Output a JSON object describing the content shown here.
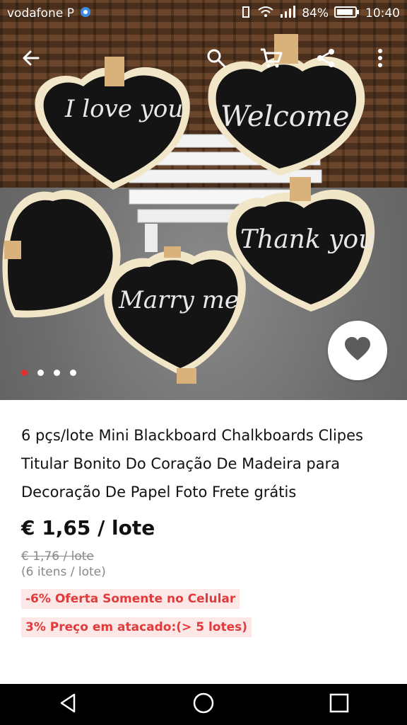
{
  "status_bar": {
    "carrier": "vodafone P",
    "battery": "84%",
    "time": "10:40"
  },
  "product": {
    "title": "6 pçs/lote Mini Blackboard Chalkboards Clipes Titular Bonito Do Coração De Madeira para Decoração De Papel Foto Frete grátis",
    "price": "€ 1,65 / lote",
    "original_price": "€ 1,76 / lote",
    "unit": "(6 itens / lote)",
    "tags": [
      {
        "discount": "-6%",
        "label": "Oferta Somente no Celular"
      },
      {
        "discount": "3%",
        "label": "Preço em atacado:(> 5 lotes)"
      }
    ]
  },
  "gallery": {
    "chalk_texts": [
      "I love you",
      "Welcome",
      "Thank you",
      "Marry me"
    ],
    "image_count": 4,
    "active_index": 0
  },
  "colors": {
    "accent": "#e62e2e",
    "tag_bg": "#fde8e8",
    "tag_text": "#e23a3a"
  },
  "icons": {
    "back": "arrow-left-icon",
    "search": "search-icon",
    "cart": "cart-icon",
    "share": "share-icon",
    "more": "more-vertical-icon",
    "favorite": "heart-icon"
  }
}
